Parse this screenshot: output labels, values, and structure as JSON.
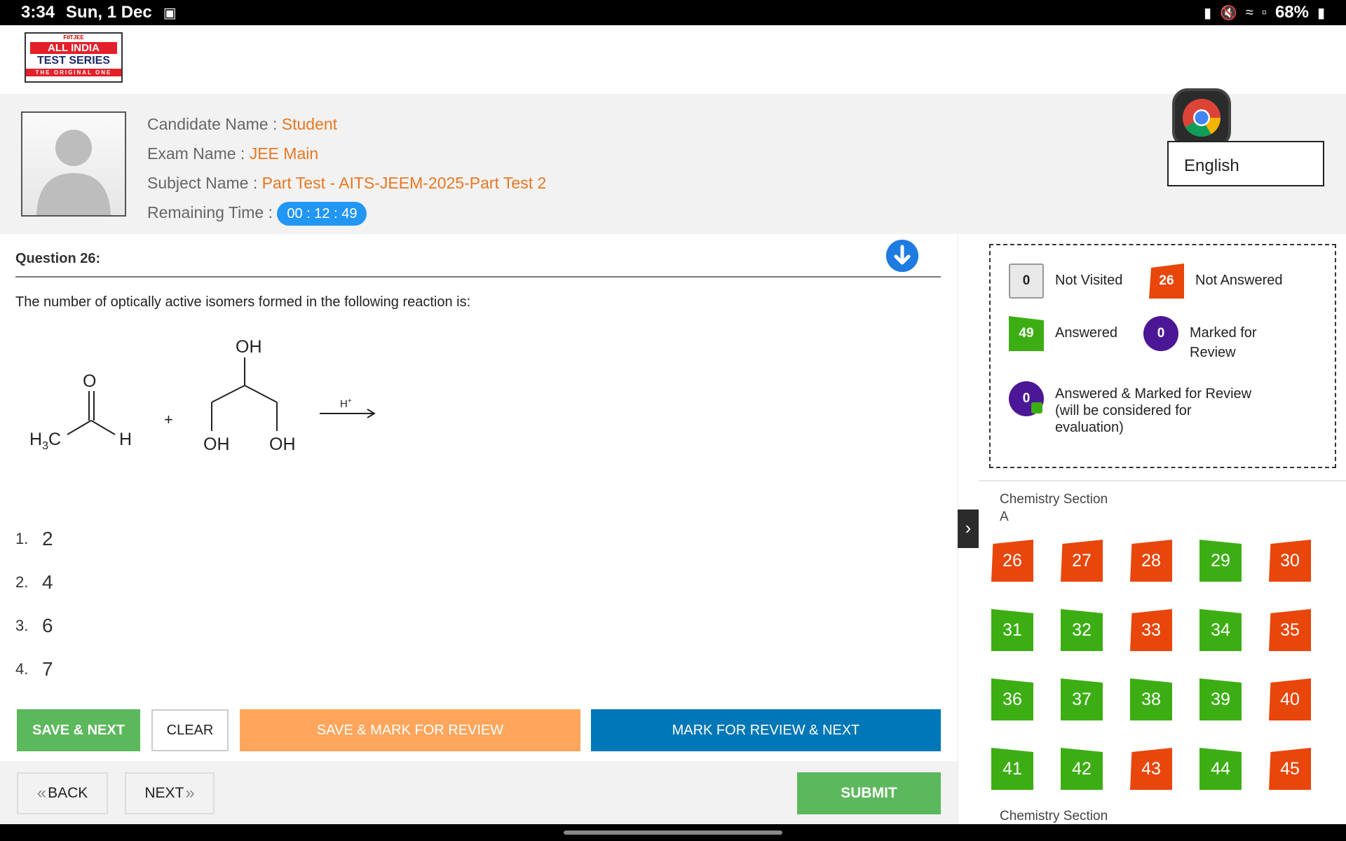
{
  "statusbar": {
    "time": "3:34",
    "date": "Sun, 1 Dec",
    "battery": "68%"
  },
  "logo": {
    "top": "FIITJEE",
    "line1": "ALL INDIA",
    "line2": "TEST SERIES",
    "line3": "THE ORIGINAL ONE"
  },
  "candidate": {
    "name_label": "Candidate Name :",
    "name": "Student",
    "exam_label": "Exam Name :",
    "exam": "JEE Main",
    "subject_label": "Subject Name :",
    "subject": "Part Test - AITS-JEEM-2025-Part Test 2",
    "time_label": "Remaining Time :",
    "time": "00 : 12 : 49"
  },
  "language": {
    "selected": "English"
  },
  "question": {
    "number": "Question 26:",
    "text": "The number of optically active isomers formed in the following reaction is:",
    "reaction": {
      "o_label": "O",
      "h3c": "H",
      "h3c_sub": "3",
      "h3c_c": "C",
      "h": "H",
      "plus": "+",
      "oh_top": "OH",
      "oh_left": "OH",
      "oh_right": "OH",
      "catalyst": "H",
      "catalyst_sup": "+"
    },
    "options": [
      {
        "num": "1.",
        "text": "2"
      },
      {
        "num": "2.",
        "text": "4"
      },
      {
        "num": "3.",
        "text": "6"
      },
      {
        "num": "4.",
        "text": "7"
      }
    ]
  },
  "actions": {
    "save_next": "SAVE & NEXT",
    "clear": "CLEAR",
    "save_mark": "SAVE & MARK FOR REVIEW",
    "mark_next": "MARK FOR REVIEW & NEXT"
  },
  "nav": {
    "back": "BACK",
    "next": "NEXT",
    "submit": "SUBMIT"
  },
  "legend": {
    "not_visited_count": "0",
    "not_visited": "Not Visited",
    "not_answered_count": "26",
    "not_answered": "Not Answered",
    "answered_count": "49",
    "answered": "Answered",
    "marked_count": "0",
    "marked_line1": "Marked for",
    "marked_line2": "Review",
    "amr_count": "0",
    "amr_line1": "Answered & Marked for Review",
    "amr_line2": "(will be considered for",
    "amr_line3": "evaluation)"
  },
  "section": {
    "name_line1": "Chemistry Section",
    "name_line2": "A",
    "next_section": "Chemistry Section"
  },
  "palette": [
    {
      "n": "26",
      "status": "not-answered"
    },
    {
      "n": "27",
      "status": "not-answered"
    },
    {
      "n": "28",
      "status": "not-answered"
    },
    {
      "n": "29",
      "status": "answered"
    },
    {
      "n": "30",
      "status": "not-answered"
    },
    {
      "n": "31",
      "status": "answered"
    },
    {
      "n": "32",
      "status": "answered"
    },
    {
      "n": "33",
      "status": "not-answered"
    },
    {
      "n": "34",
      "status": "answered"
    },
    {
      "n": "35",
      "status": "not-answered"
    },
    {
      "n": "36",
      "status": "answered"
    },
    {
      "n": "37",
      "status": "answered"
    },
    {
      "n": "38",
      "status": "answered"
    },
    {
      "n": "39",
      "status": "answered"
    },
    {
      "n": "40",
      "status": "not-answered"
    },
    {
      "n": "41",
      "status": "answered"
    },
    {
      "n": "42",
      "status": "answered"
    },
    {
      "n": "43",
      "status": "not-answered"
    },
    {
      "n": "44",
      "status": "answered"
    },
    {
      "n": "45",
      "status": "not-answered"
    }
  ],
  "colors": {
    "not_answered": "#e8460a",
    "answered": "#3cae13",
    "marked": "#4b1796",
    "accent": "#e87722",
    "timer": "#2196f3"
  }
}
